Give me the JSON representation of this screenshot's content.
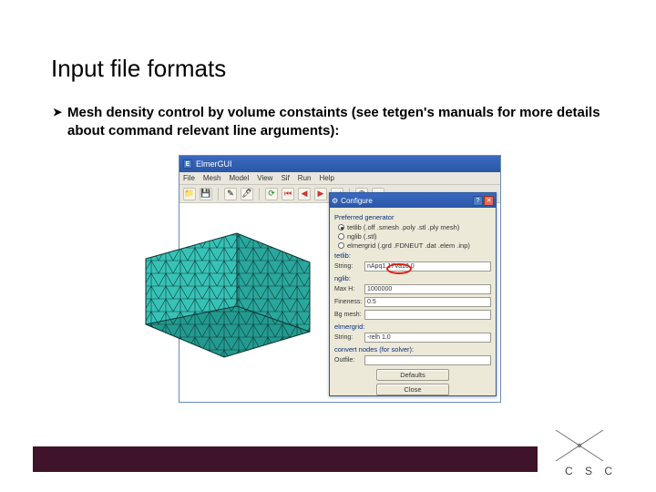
{
  "slide": {
    "title": "Input file formats",
    "bullet_text": "Mesh density control by volume constaints (see tetgen's manuals for more details about command relevant line arguments):"
  },
  "appwindow": {
    "title": "ElmerGUI",
    "menu": {
      "file": "File",
      "mesh": "Mesh",
      "model": "Model",
      "view": "View",
      "sif": "Sif",
      "run": "Run",
      "help": "Help"
    }
  },
  "dialog": {
    "title": "Configure",
    "group_generator": "Preferred generator",
    "radio1": "tetlib (.off .smesh .poly .stl .ply mesh)",
    "radio2": "nglib (.stl)",
    "radio3": "elmergrid (.grd .FDNEUT .dat .elem .inp)",
    "section_tetlib": "tetlib:",
    "tetlib_label": "String:",
    "tetlib_value_pre": "nApq1.",
    "tetlib_value_hl": "17Va10.0",
    "section_nglib": "nglib:",
    "maxh_label": "Max H:",
    "maxh_value": "1000000",
    "fineness_label": "Fineness:",
    "fineness_value": "0.5",
    "bgmesh_label": "Bg mesh:",
    "bgmesh_value": "",
    "section_elmergrid": "elmergrid:",
    "eg_string_label": "String:",
    "eg_string_value": "-relh 1.0",
    "section_conv": "convert nodes (for solver):",
    "outfile_label": "Outfile:",
    "outfile_value": "",
    "btn_defaults": "Defaults",
    "btn_close": "Close"
  },
  "footer": {
    "logo_text": "C S C"
  }
}
